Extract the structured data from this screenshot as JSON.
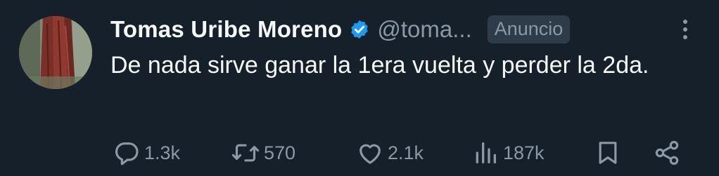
{
  "tweet": {
    "author_name": "Tomas Uribe Moreno",
    "author_handle": "@toma...",
    "ad_label": "Anuncio",
    "text": "De nada sirve ganar la 1era vuelta y perder la 2da."
  },
  "actions": {
    "reply_count": "1.3k",
    "retweet_count": "570",
    "like_count": "2.1k",
    "view_count": "187k"
  },
  "icons": {
    "verified": "verified-badge-icon",
    "more": "more-vertical-icon",
    "reply": "reply-icon",
    "retweet": "retweet-icon",
    "like": "heart-icon",
    "views": "views-chart-icon",
    "bookmark": "bookmark-icon",
    "share": "share-icon"
  },
  "colors": {
    "background": "#15202b",
    "text_primary": "#f7f9f9",
    "text_secondary": "#8b98a5",
    "verified_blue": "#1d9bf0",
    "badge_bg": "#2e3b48"
  }
}
